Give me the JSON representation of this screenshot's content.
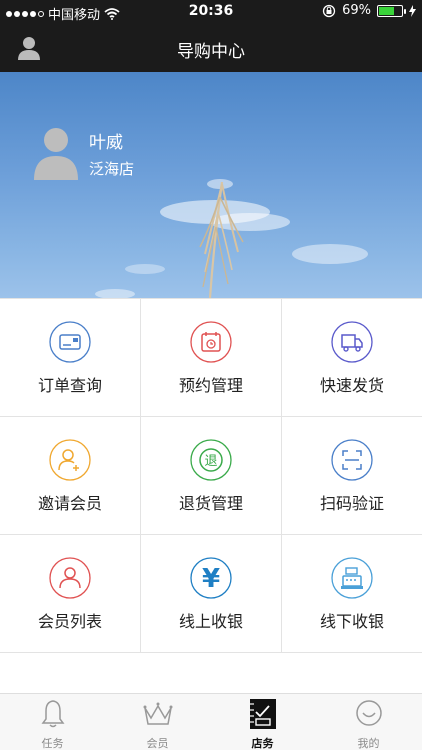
{
  "status_bar": {
    "carrier": "中国移动",
    "time": "20:36",
    "battery": "69%",
    "battery_level": 0.69
  },
  "nav": {
    "title": "导购中心"
  },
  "profile": {
    "name": "叶威",
    "store": "泛海店"
  },
  "menu": [
    {
      "label": "订单查询",
      "icon": "order-card-icon",
      "color": "#4a7fc9"
    },
    {
      "label": "预约管理",
      "icon": "calendar-icon",
      "color": "#e05252"
    },
    {
      "label": "快速发货",
      "icon": "truck-icon",
      "color": "#5a5acb"
    },
    {
      "label": "邀请会员",
      "icon": "invite-user-icon",
      "color": "#f0a830"
    },
    {
      "label": "退货管理",
      "icon": "return-icon",
      "color": "#3aaa4a"
    },
    {
      "label": "扫码验证",
      "icon": "scan-icon",
      "color": "#4a7fc9"
    },
    {
      "label": "会员列表",
      "icon": "member-icon",
      "color": "#e05252"
    },
    {
      "label": "线上收银",
      "icon": "yen-icon",
      "color": "#1f7fc4"
    },
    {
      "label": "线下收银",
      "icon": "register-icon",
      "color": "#4aa0d8"
    }
  ],
  "return_glyph": "退",
  "yen_glyph": "¥",
  "tabs": [
    {
      "label": "任务",
      "icon": "bell-icon"
    },
    {
      "label": "会员",
      "icon": "crown-icon"
    },
    {
      "label": "店务",
      "icon": "notebook-icon",
      "active": true
    },
    {
      "label": "我的",
      "icon": "smiley-icon"
    }
  ]
}
